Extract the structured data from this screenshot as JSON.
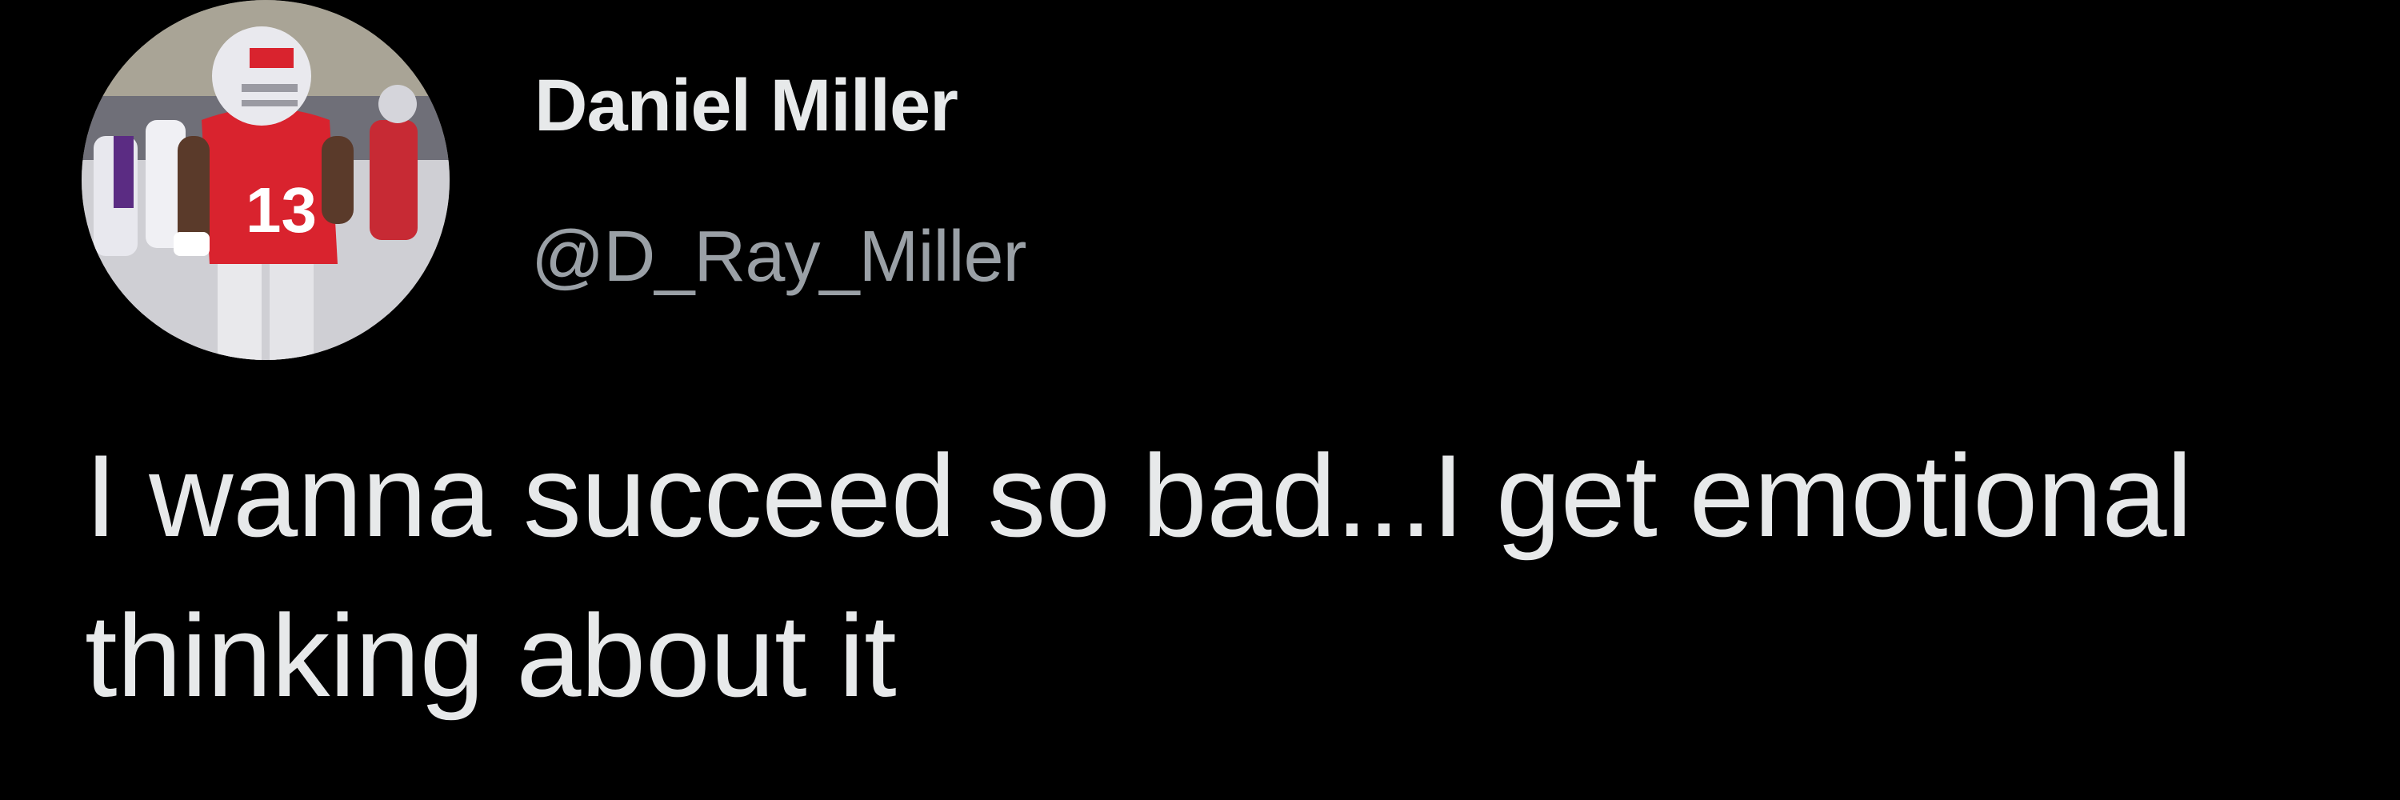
{
  "tweet": {
    "author": {
      "display_name": "Daniel Miller",
      "handle": "@D_Ray_Miller",
      "avatar_icon": "football-player-avatar"
    },
    "text": "I wanna succeed so bad...I get emotional thinking about it"
  },
  "colors": {
    "background": "#000000",
    "primary_text": "#e7e9ea",
    "secondary_text": "#9aa0a6",
    "jersey_red": "#d9232e"
  }
}
